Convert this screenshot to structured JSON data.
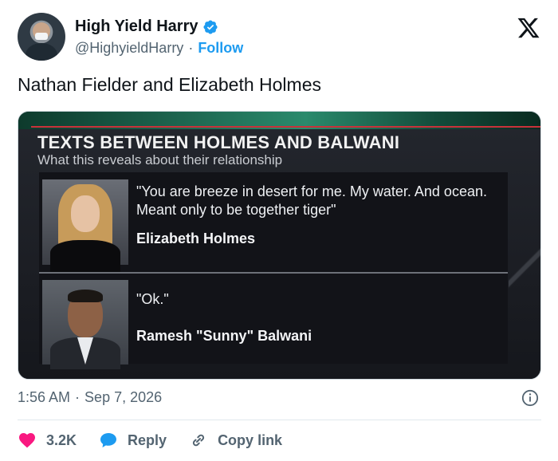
{
  "author": {
    "display_name": "High Yield Harry",
    "handle": "@HighyieldHarry",
    "separator": "·",
    "follow_label": "Follow"
  },
  "tweet": {
    "text": "Nathan Fielder and Elizabeth Holmes"
  },
  "media": {
    "headline": "TEXTS BETWEEN HOLMES AND BALWANI",
    "subhead": "What this reveals about their relationship",
    "messages": [
      {
        "quote": "\"You are breeze in desert for me. My water. And ocean. Meant only to be together tiger\"",
        "speaker": "Elizabeth Holmes"
      },
      {
        "quote": "\"Ok.\"",
        "speaker": "Ramesh \"Sunny\" Balwani"
      }
    ]
  },
  "meta": {
    "time": "1:56 AM",
    "separator": "·",
    "date": "Sep 7, 2026"
  },
  "actions": {
    "likes": "3.2K",
    "reply_label": "Reply",
    "copy_link_label": "Copy link"
  },
  "colors": {
    "accent": "#1d9bf0",
    "like": "#f91880",
    "muted": "#536471"
  },
  "icons": [
    "verified-badge-icon",
    "x-logo-icon",
    "info-icon",
    "heart-icon",
    "reply-icon",
    "link-icon"
  ]
}
